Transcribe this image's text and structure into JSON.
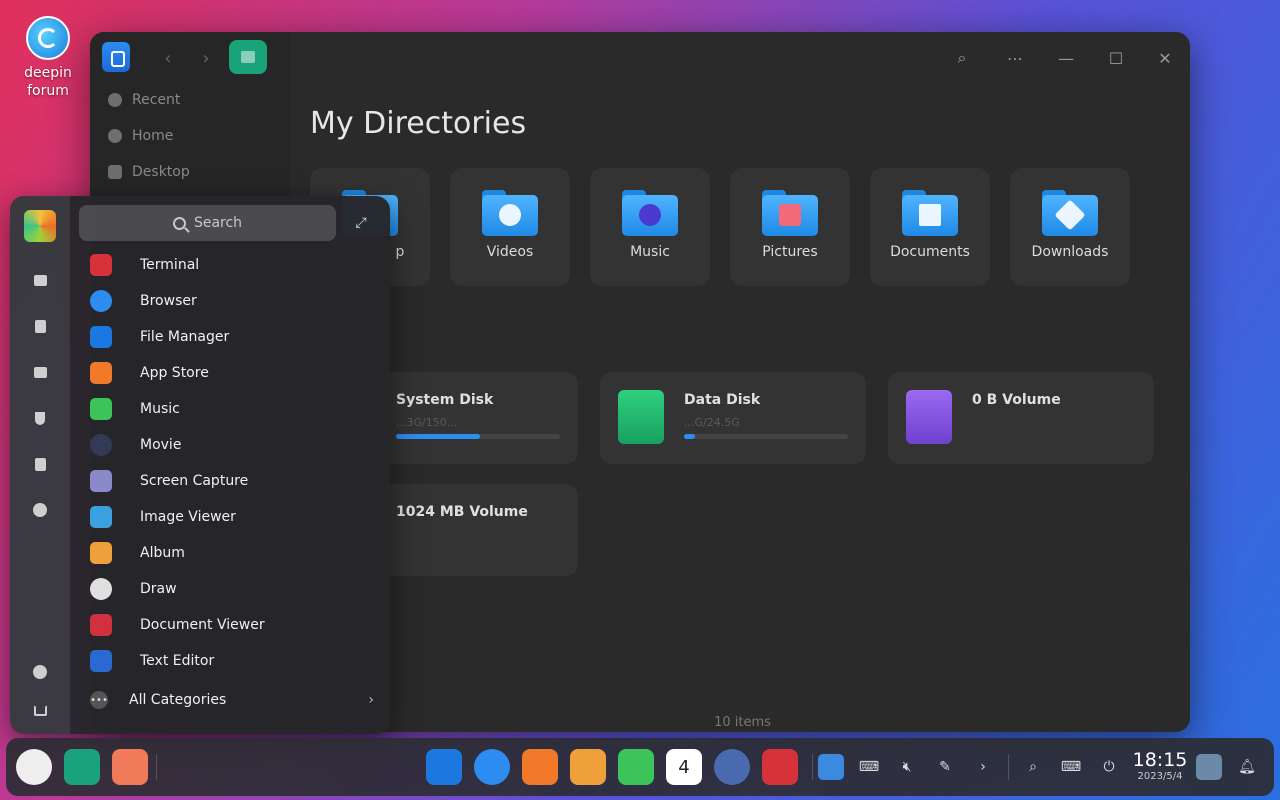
{
  "desktop": {
    "icon_label": "deepin\nforum",
    "icon_line1": "deepin",
    "icon_line2": "forum"
  },
  "file_manager": {
    "sidebar": [
      {
        "label": "Recent",
        "icon": "clock-icon"
      },
      {
        "label": "Home",
        "icon": "home-icon"
      },
      {
        "label": "Desktop",
        "icon": "desktop-icon"
      }
    ],
    "title": "My Directories",
    "directories": [
      {
        "name": "p",
        "icon": "desktop-folder-icon"
      },
      {
        "name": "Videos",
        "icon": "videos-folder-icon"
      },
      {
        "name": "Music",
        "icon": "music-folder-icon"
      },
      {
        "name": "Pictures",
        "icon": "pictures-folder-icon"
      },
      {
        "name": "Documents",
        "icon": "documents-folder-icon"
      },
      {
        "name": "Downloads",
        "icon": "downloads-folder-icon"
      }
    ],
    "disks": [
      {
        "name": "System Disk",
        "size": "...3G/150...",
        "usage_fraction": 0.51,
        "color": "#2d8cf0"
      },
      {
        "name": "Data Disk",
        "size": "...G/24.5G",
        "usage_fraction": 0.07,
        "color": "#1fb86f"
      },
      {
        "name": "0 B Volume",
        "size": "",
        "color": "#8a5ae0"
      },
      {
        "name": "1024 MB Volume",
        "size": ""
      }
    ],
    "status": "10 items"
  },
  "launcher": {
    "search_placeholder": "Search",
    "apps": [
      {
        "name": "Terminal",
        "icon": "terminal-icon",
        "color": "#d7323a"
      },
      {
        "name": "Browser",
        "icon": "browser-icon",
        "color": "#2d8cf0"
      },
      {
        "name": "File Manager",
        "icon": "file-manager-icon",
        "color": "#1a78e0"
      },
      {
        "name": "App Store",
        "icon": "app-store-icon",
        "color": "#f07a2a"
      },
      {
        "name": "Music",
        "icon": "music-icon",
        "color": "#3cc35a"
      },
      {
        "name": "Movie",
        "icon": "movie-icon",
        "color": "#333a55"
      },
      {
        "name": "Screen Capture",
        "icon": "screen-capture-icon",
        "color": "#8a8acb"
      },
      {
        "name": "Image Viewer",
        "icon": "image-viewer-icon",
        "color": "#3aa0e0"
      },
      {
        "name": "Album",
        "icon": "album-icon",
        "color": "#f0a03a"
      },
      {
        "name": "Draw",
        "icon": "draw-icon",
        "color": "#e0e0e0"
      },
      {
        "name": "Document Viewer",
        "icon": "document-viewer-icon",
        "color": "#d03040"
      },
      {
        "name": "Text Editor",
        "icon": "text-editor-icon",
        "color": "#2a6ad0"
      }
    ],
    "all_categories": "All Categories"
  },
  "dock": {
    "time": "18:15",
    "date": "2023/5/4",
    "calendar_day": "4"
  }
}
